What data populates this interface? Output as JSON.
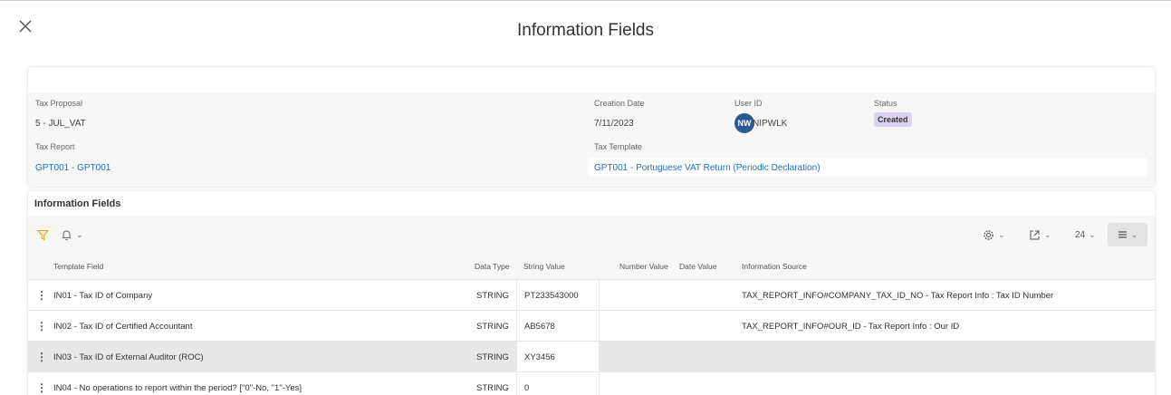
{
  "dialog": {
    "title": "Information Fields"
  },
  "header": {
    "tax_proposal": {
      "label": "Tax Proposal",
      "value": "5 - JUL_VAT"
    },
    "creation_date": {
      "label": "Creation Date",
      "value": "7/11/2023"
    },
    "user_id": {
      "label": "User ID",
      "initials": "NW",
      "value": "NIPWLK"
    },
    "status": {
      "label": "Status",
      "value": "Created"
    },
    "tax_report": {
      "label": "Tax Report",
      "value": "GPT001 - GPT001"
    },
    "tax_template": {
      "label": "Tax Template",
      "value": "GPT001 - Portuguese VAT Return (Periodic Declaration)"
    }
  },
  "section": {
    "title": "Information Fields"
  },
  "toolbar": {
    "filter_icon": "filter-icon",
    "bell_icon": "bell-icon",
    "settings_icon": "gear-icon",
    "export_icon": "export-icon",
    "page_size": "24",
    "view_icon": "list-view-icon"
  },
  "table": {
    "columns": [
      "Template Field",
      "Data Type",
      "String Value",
      "Number Value",
      "Date Value",
      "Information Source"
    ],
    "rows": [
      {
        "template_field": "IN01 - Tax ID of Company",
        "data_type": "STRING",
        "string_value": "PT233543000",
        "number_value": "",
        "date_value": "",
        "information_source": "TAX_REPORT_INFO#COMPANY_TAX_ID_NO - Tax Report Info : Tax ID Number"
      },
      {
        "template_field": "IN02 - Tax ID of Certified Accountant",
        "data_type": "STRING",
        "string_value": "AB5678",
        "number_value": "",
        "date_value": "",
        "information_source": "TAX_REPORT_INFO#OUR_ID - Tax Report Info : Our ID"
      },
      {
        "template_field": "IN03 - Tax ID of External Auditor (ROC)",
        "data_type": "STRING",
        "string_value": "XY3456",
        "number_value": "",
        "date_value": "",
        "information_source": ""
      },
      {
        "template_field": "IN04 - No operations to report within the period?  [\"0\"-No, \"1\"-Yes]",
        "data_type": "STRING",
        "string_value": "0",
        "number_value": "",
        "date_value": "",
        "information_source": ""
      }
    ]
  },
  "colors": {
    "accent": "#1f6fb8",
    "avatar": "#2b5a93",
    "status_badge": "#dcd3f0",
    "filter_icon": "#e0a800",
    "row_highlight": "#e8e8e8"
  }
}
